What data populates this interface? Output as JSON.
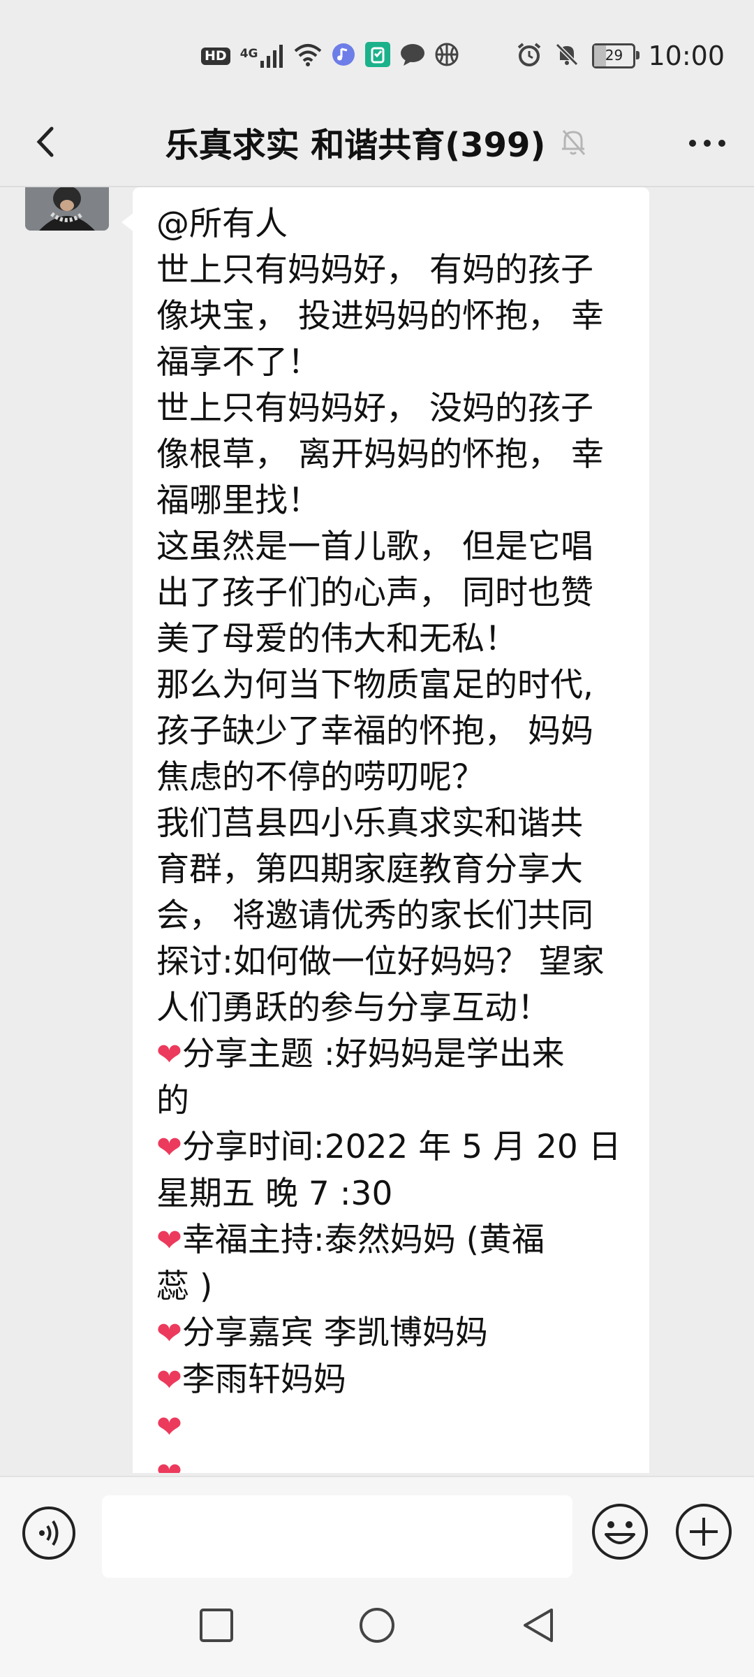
{
  "status_bar": {
    "hd": "HD",
    "signal_label": "4G",
    "battery_level": "29",
    "battery_fraction": 0.29,
    "time": "10:00",
    "icons": [
      "hd-icon",
      "signal-icon",
      "wifi-icon",
      "music-icon",
      "app-icon",
      "message-icon",
      "basketball-icon",
      "alarm-icon",
      "mute-icon",
      "battery-icon"
    ]
  },
  "header": {
    "title": "乐真求实 和谐共育(399)",
    "back_icon": "chevron-left-icon",
    "mute_icon": "bell-off-icon",
    "more_icon": "more-icon"
  },
  "message": {
    "lines": [
      "@所有人",
      "世上只有妈妈好， 有妈的孩子",
      "像块宝， 投进妈妈的怀抱， 幸",
      "福享不了！",
      "世上只有妈妈好， 没妈的孩子",
      "像根草， 离开妈妈的怀抱， 幸",
      "福哪里找！",
      "这虽然是一首儿歌， 但是它唱",
      "出了孩子们的心声， 同时也赞",
      "美了母爱的伟大和无私！",
      "那么为何当下物质富足的时代,",
      "孩子缺少了幸福的怀抱， 妈妈",
      "焦虑的不停的唠叨呢？",
      "我们莒县四小乐真求实和谐共",
      "育群，第四期家庭教育分享大",
      "会， 将邀请优秀的家长们共同",
      "探讨:如何做一位好妈妈？ 望家",
      "人们勇跃的参与分享互动！",
      "❤分享主题 :好妈妈是学出来",
      "的",
      "❤分享时间:2022 年 5 月 20 日",
      "星期五 晚 7 :30",
      "❤幸福主持:泰然妈妈 (黄福",
      "蕊 )",
      "❤分享嘉宾 李凯博妈妈",
      "❤李雨轩妈妈",
      "❤",
      "❤"
    ]
  },
  "input_bar": {
    "voice_icon": "voice-icon",
    "emoji_icon": "emoji-icon",
    "add_icon": "add-icon",
    "text_value": ""
  },
  "nav_bar": {
    "icons": [
      "recent-apps-icon",
      "home-icon",
      "back-icon"
    ]
  }
}
